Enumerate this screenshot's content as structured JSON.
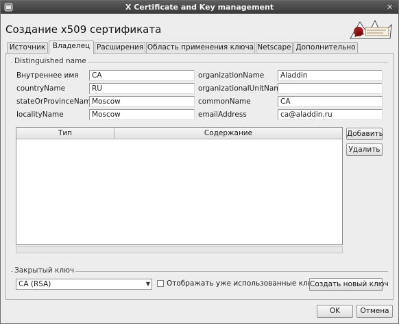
{
  "window": {
    "title": "X Certificate and Key management"
  },
  "heading": "Создание x509 сертификата",
  "tabs": [
    {
      "label": "Источник"
    },
    {
      "label": "Владелец"
    },
    {
      "label": "Расширения"
    },
    {
      "label": "Область применения ключа"
    },
    {
      "label": "Netscape"
    },
    {
      "label": "Дополнительно"
    }
  ],
  "active_tab": "Владелец",
  "distinguished_name": {
    "group_label": "Distinguished name",
    "left": [
      {
        "label": "Внутреннее имя",
        "value": "CA"
      },
      {
        "label": "countryName",
        "value": "RU"
      },
      {
        "label": "stateOrProvinceName",
        "value": "Moscow"
      },
      {
        "label": "localityName",
        "value": "Moscow"
      }
    ],
    "right": [
      {
        "label": "organizationName",
        "value": "Aladdin"
      },
      {
        "label": "organizationalUnitName",
        "value": ""
      },
      {
        "label": "commonName",
        "value": "CA"
      },
      {
        "label": "emailAddress",
        "value": "ca@aladdin.ru"
      }
    ]
  },
  "table": {
    "columns": [
      "Тип",
      "Содержание"
    ],
    "rows": []
  },
  "buttons": {
    "add": "Добавить",
    "remove": "Удалить",
    "create_key": "Создать новый ключ",
    "ok": "OK",
    "cancel": "Отмена"
  },
  "private_key": {
    "group_label": "Закрытый ключ",
    "selected": "CA (RSA)",
    "show_used_label": "Отображать уже использованные ключи",
    "show_used_checked": false
  },
  "icons": {
    "window": "app-icon",
    "close": "close-icon",
    "logo": "logo-icon",
    "combo": "chevron-down-icon"
  }
}
